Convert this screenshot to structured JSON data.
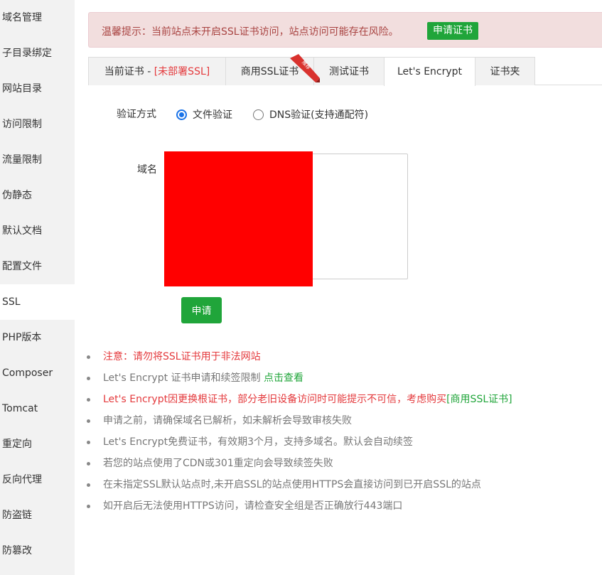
{
  "sidebar": {
    "items": [
      {
        "label": "域名管理"
      },
      {
        "label": "子目录绑定"
      },
      {
        "label": "网站目录"
      },
      {
        "label": "访问限制"
      },
      {
        "label": "流量限制"
      },
      {
        "label": "伪静态"
      },
      {
        "label": "默认文档"
      },
      {
        "label": "配置文件"
      },
      {
        "label": "SSL"
      },
      {
        "label": "PHP版本"
      },
      {
        "label": "Composer"
      },
      {
        "label": "Tomcat"
      },
      {
        "label": "重定向"
      },
      {
        "label": "反向代理"
      },
      {
        "label": "防盗链"
      },
      {
        "label": "防篡改"
      }
    ],
    "active_index": 8
  },
  "alert": {
    "text": "温馨提示：当前站点未开启SSL证书访问，站点访问可能存在风险。",
    "button_label": "申请证书"
  },
  "tabs": {
    "current_prefix": "当前证书 - ",
    "current_status": "[未部署SSL]",
    "commercial": "商用SSL证书",
    "commercial_badge": "推荐",
    "test": "测试证书",
    "letsencrypt": "Let's Encrypt",
    "folder": "证书夹",
    "active": "letsencrypt"
  },
  "form": {
    "verify_label": "验证方式",
    "option_file": "文件验证",
    "option_dns": "DNS验证(支持通配符)",
    "selected_option": "file",
    "domain_label": "域名",
    "apply_button": "申请"
  },
  "notes": [
    {
      "text": "注意：请勿将SSL证书用于非法网站",
      "style": "red"
    },
    {
      "text": "Let's Encrypt 证书申请和续签限制 ",
      "link": "点击查看",
      "style": "gray"
    },
    {
      "text": "Let's Encrypt因更换根证书，部分老旧设备访问时可能提示不可信，考虑购买",
      "link": "[商用SSL证书]",
      "style": "red"
    },
    {
      "text": "申请之前，请确保域名已解析，如未解析会导致审核失败",
      "style": "gray"
    },
    {
      "text": "Let's Encrypt免费证书，有效期3个月，支持多域名。默认会自动续签",
      "style": "gray"
    },
    {
      "text": "若您的站点使用了CDN或301重定向会导致续签失败",
      "style": "gray"
    },
    {
      "text": "在未指定SSL默认站点时,未开启SSL的站点使用HTTPS会直接访问到已开启SSL的站点",
      "style": "gray"
    },
    {
      "text": "如开启后无法使用HTTPS访问，请检查安全组是否正确放行443端口",
      "style": "gray"
    }
  ],
  "colors": {
    "accent_green": "#20a53a",
    "alert_bg": "#f2dede",
    "alert_text": "#a94442",
    "warning_red": "#e4393c",
    "redaction_red": "#ff0000"
  }
}
